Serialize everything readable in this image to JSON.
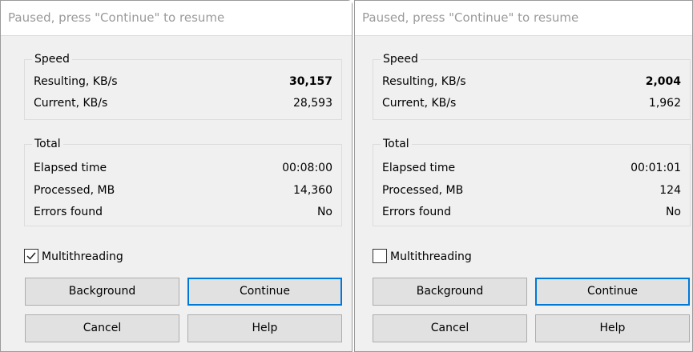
{
  "dialogs": [
    {
      "title": "Paused, press \"Continue\" to resume",
      "speed": {
        "legend": "Speed",
        "resulting_label": "Resulting, KB/s",
        "resulting_value": "30,157",
        "current_label": "Current, KB/s",
        "current_value": "28,593"
      },
      "total": {
        "legend": "Total",
        "elapsed_label": "Elapsed time",
        "elapsed_value": "00:08:00",
        "processed_label": "Processed, MB",
        "processed_value": "14,360",
        "errors_label": "Errors found",
        "errors_value": "No"
      },
      "multithreading": {
        "label": "Multithreading",
        "checked": true
      },
      "buttons": {
        "background": "Background",
        "continue": "Continue",
        "cancel": "Cancel",
        "help": "Help"
      }
    },
    {
      "title": "Paused, press \"Continue\" to resume",
      "speed": {
        "legend": "Speed",
        "resulting_label": "Resulting, KB/s",
        "resulting_value": "2,004",
        "current_label": "Current, KB/s",
        "current_value": "1,962"
      },
      "total": {
        "legend": "Total",
        "elapsed_label": "Elapsed time",
        "elapsed_value": "00:01:01",
        "processed_label": "Processed, MB",
        "processed_value": "124",
        "errors_label": "Errors found",
        "errors_value": "No"
      },
      "multithreading": {
        "label": "Multithreading",
        "checked": false
      },
      "buttons": {
        "background": "Background",
        "continue": "Continue",
        "cancel": "Cancel",
        "help": "Help"
      }
    }
  ],
  "colors": {
    "dialog_bg": "#f0f0f0",
    "title_text": "#9a9a9a",
    "button_bg": "#e1e1e1",
    "default_button_border": "#0078d7"
  }
}
